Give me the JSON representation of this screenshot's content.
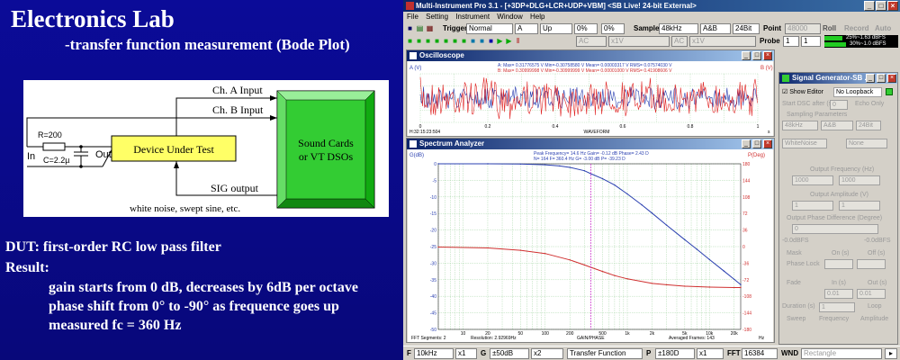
{
  "slide": {
    "title": "Electronics Lab",
    "subtitle": "-transfer function measurement (Bode Plot)",
    "diagram": {
      "r_label": "R=200",
      "c_label": "C=2.2µ",
      "in_label": "In",
      "out_label": "Out",
      "dut_label": "Device Under Test",
      "sound_line1": "Sound Cards",
      "sound_line2": "or VT DSOs",
      "ch_a": "Ch. A Input",
      "ch_b": "Ch. B Input",
      "sig": "SIG output",
      "noise": "white noise, swept sine, etc."
    },
    "dut_line": "DUT: first-order RC low pass filter",
    "result_label": "Result:",
    "results": [
      "gain starts from 0 dB, decreases by 6dB per octave",
      "phase shift from 0° to -90° as frequence goes up",
      "measured fc = 360 Hz"
    ]
  },
  "app": {
    "title": "Multi-Instrument Pro 3.1  -  [+3DP+DLG+LCR+UDP+VBM]       <SB Live! 24-bit External>",
    "menu": [
      "File",
      "Setting",
      "Instrument",
      "Window",
      "Help"
    ],
    "toolbar1": {
      "trigger_label": "Trigger",
      "trigger_mode": "Normal",
      "trig_channel": "A",
      "trig_edge": "Up",
      "pct1": "0%",
      "pct2": "0%",
      "sample_label": "Sample",
      "sample_rate": "48kHz",
      "channels": "A&B",
      "bits": "24Bit",
      "point_label": "Point",
      "point_value": "48000",
      "roll_label": "Roll",
      "record_label": "Record",
      "auto_label": "Auto"
    },
    "toolbar2": {
      "ac1": "AC",
      "x1": "x1V",
      "ac2": "AC",
      "x2": "x1V",
      "probe_label": "Probe",
      "probe1": "1",
      "probe2": "1",
      "status1": "25%~1.63 dBFS",
      "status2": "30%~1.0 dBFS"
    },
    "oscilloscope": {
      "title": "Oscilloscope",
      "axis_left": "A (V)",
      "axis_right": "B (V)",
      "statsA": "A: Max= 0.31776575 V   Min=-0.30758580 V   Mean= 0.00003317 V   RMS= 0.07574030 V",
      "statsB": "B: Max= 0.30999998 V   Min=-0.30999999 V   Mean= 0.00001000 V   RMS= 0.41908606 V",
      "time": "H:32:15:23:504",
      "xlabel": "WAVEFORM",
      "xticks": [
        "0",
        "0.2",
        "0.4",
        "0.6",
        "0.8",
        "1"
      ],
      "xunit": "s"
    },
    "spectrum": {
      "title": "Spectrum Analyzer",
      "axis_left": "G(dB)",
      "axis_right": "P(Deg)",
      "peak1": "Peak Frequency= 14.6 Hz   Gain= -0.12 dB   Phase= 2.43 D",
      "peak2": "N= 164   F= 360.4 Hz   G= -3.00 dB   P= -39.23 D",
      "footer_left": "FFT Segments: 2",
      "footer_res": "Resolution: 2.92969Hz",
      "footer_label": "GAIN/PHASE",
      "footer_avg": "Averaged Frames: 143",
      "footer_unit": "Hz"
    },
    "chart_data": {
      "type": "line",
      "x_scale": "log",
      "xlim": [
        5,
        24000
      ],
      "x_ticks": [
        10,
        20,
        50,
        100,
        200,
        500,
        1000,
        2000,
        5000,
        10000,
        20000
      ],
      "x_tick_labels": [
        "10",
        "20",
        "50",
        "100",
        "200",
        "500",
        "1k",
        "2k",
        "5k",
        "10k",
        "20k"
      ],
      "gain": {
        "ylim": [
          -50,
          0
        ],
        "y_ticks": [
          0,
          -5,
          -10,
          -15,
          -20,
          -25,
          -30,
          -35,
          -40,
          -45,
          -50
        ],
        "y_tick_labels": [
          "0",
          "-5",
          "-10",
          "-15",
          "-20",
          "-25",
          "-30",
          "-35",
          "-40",
          "-45",
          "-50"
        ],
        "color": "#2a3fb0",
        "x": [
          5,
          20,
          50,
          100,
          150,
          200,
          300,
          360,
          500,
          700,
          1000,
          1500,
          2000,
          3000,
          5000,
          7000,
          10000,
          15000,
          20000,
          24000
        ],
        "values": [
          0,
          -0.01,
          -0.08,
          -0.3,
          -0.65,
          -1.1,
          -2.1,
          -3.0,
          -4.5,
          -6.4,
          -9.1,
          -12.4,
          -14.9,
          -18.5,
          -22.9,
          -25.8,
          -28.9,
          -32.4,
          -34.9,
          -36.5
        ]
      },
      "phase": {
        "ylim": [
          -180,
          180
        ],
        "y_ticks": [
          180,
          144,
          108,
          72,
          36,
          0,
          -36,
          -72,
          -108,
          -144,
          -180
        ],
        "y_tick_labels": [
          "180",
          "144",
          "108",
          "72",
          "36",
          "0",
          "-36",
          "-72",
          "-108",
          "-144",
          "-180"
        ],
        "color": "#d03030",
        "x": [
          5,
          20,
          50,
          100,
          200,
          300,
          360,
          500,
          700,
          1000,
          2000,
          3000,
          5000,
          10000,
          20000,
          24000
        ],
        "values": [
          -1,
          -3,
          -8,
          -15,
          -29,
          -40,
          -45,
          -54,
          -63,
          -70,
          -80,
          -83,
          -86,
          -88,
          -89,
          -89
        ]
      },
      "cursor_x": 360
    },
    "siggen": {
      "title": "Signal Generator-SB ...",
      "show_editor": "Show Editor",
      "loopback": "No Loopback",
      "start_dsc": "Start DSC after (s)",
      "start_val": "0",
      "echo": "Echo Only",
      "sampling": "Sampling Parameters",
      "rate": "48kHz",
      "ch": "A&B",
      "bits": "24Bit",
      "wave": "WhiteNoise",
      "none": "None",
      "freq_label": "Output Frequency (Hz)",
      "freq1": "1000",
      "freq2": "1000",
      "amp_label": "Output Amplitude (V)",
      "amp1": "1",
      "amp2": "1",
      "phase_label": "Output Phase Difference (Degree)",
      "phase_val": "0",
      "dbfs1": "-0.0dBFS",
      "dbfs2": "-0.0dBFS",
      "mask": "Mask",
      "on": "On (s)",
      "off": "Off (s)",
      "phase_lock": "Phase Lock",
      "fade": "Fade",
      "in": "In (s)",
      "out": "Out (s)",
      "in_val": "0.01",
      "out_val": "0.01",
      "duration": "Duration (s)",
      "dur_val": "1",
      "loop": "Loop",
      "sweep": "Sweep",
      "frequency": "Frequency",
      "amplitude": "Amplitude"
    },
    "bottombar": {
      "f_label": "F",
      "f_val": "10kHz",
      "x1": "x1",
      "g_label": "G",
      "g_val": "±50dB",
      "x2": "x2",
      "mode": "Transfer Function",
      "p_label": "P",
      "p_val": "±180D",
      "x3": "x1",
      "fft_label": "FFT",
      "fft_val": "16384",
      "wnd_label": "WND",
      "wnd_val": "Rectangle"
    }
  }
}
